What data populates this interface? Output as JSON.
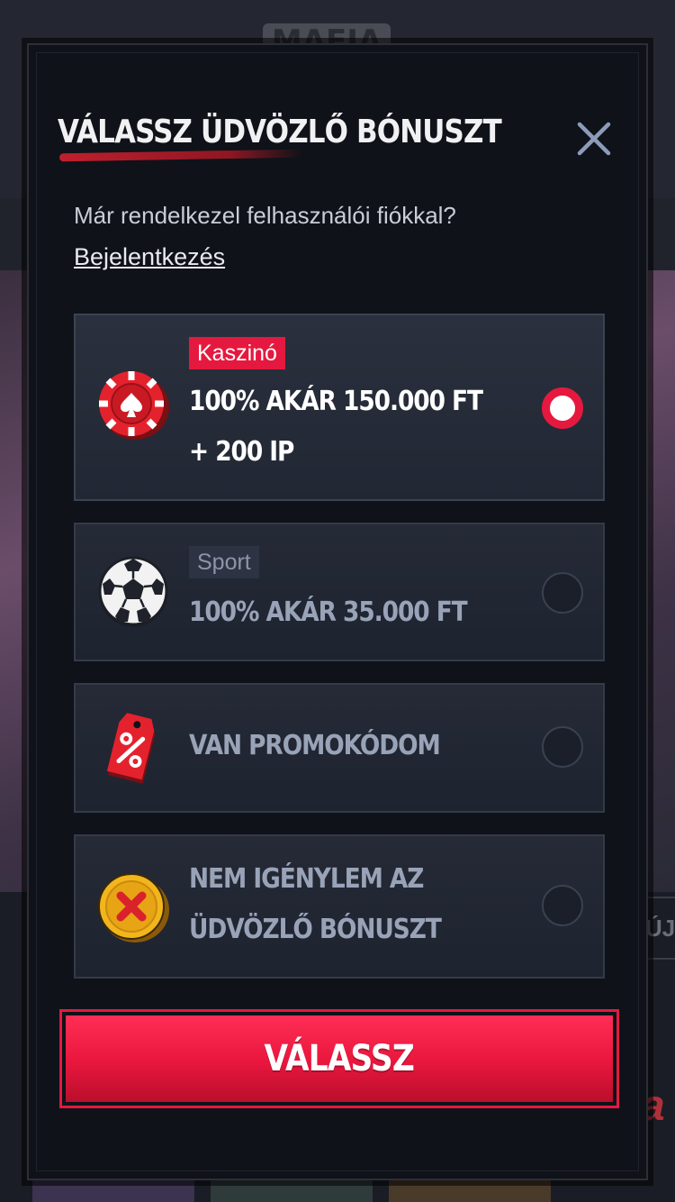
{
  "background": {
    "logo_text": "MAFIA",
    "side_badge": "ÚJ"
  },
  "modal": {
    "title": "VÁLASSZ ÜDVÖZLŐ BÓNUSZT",
    "account_question": "Már rendelkezel felhasználói fiókkal?",
    "login_link": "Bejelentkezés",
    "options": [
      {
        "icon": "casino-chip-icon",
        "tag": "Kaszinó",
        "title_line1": "100% AKÁR 150.000 FT",
        "title_line2": "+ 200 IP",
        "selected": true
      },
      {
        "icon": "soccer-ball-icon",
        "tag": "Sport",
        "title_line1": "100% AKÁR 35.000 FT",
        "selected": false
      },
      {
        "icon": "promo-tag-icon",
        "title_line1": "VAN PROMOKÓDOM",
        "selected": false
      },
      {
        "icon": "no-bonus-coin-icon",
        "title_line1": "NEM IGÉNYLEM AZ",
        "title_line2": "ÜDVÖZLŐ BÓNUSZT",
        "selected": false
      }
    ],
    "submit_label": "VÁLASSZ"
  },
  "colors": {
    "accent": "#e5193f",
    "modal_bg": "#0f1219",
    "option_bg": "#252a36",
    "muted_text": "#99a3b8"
  }
}
